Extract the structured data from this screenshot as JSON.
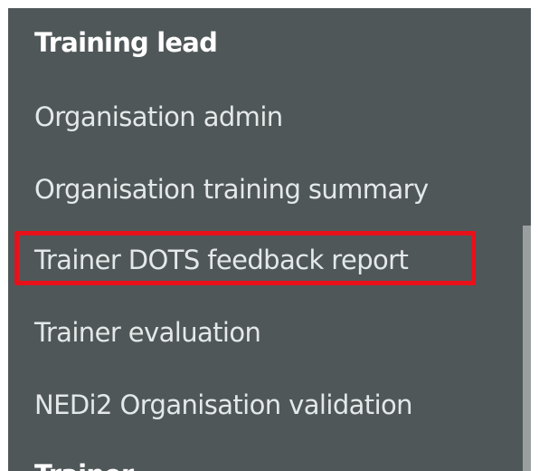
{
  "menu": {
    "section_heading": "Training lead",
    "items": [
      {
        "label": "Organisation admin"
      },
      {
        "label": "Organisation training summary"
      },
      {
        "label": "Trainer DOTS feedback report"
      },
      {
        "label": "Trainer evaluation"
      },
      {
        "label": "NEDi2 Organisation validation"
      }
    ],
    "next_section_heading": "Trainer"
  },
  "colors": {
    "panel_background": "#4f5759",
    "highlight": "#e8111a"
  }
}
